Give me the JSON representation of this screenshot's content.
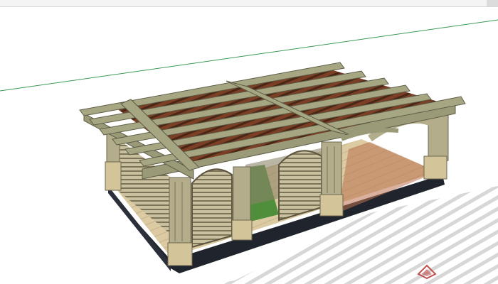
{
  "viewport": {
    "model": "pergola",
    "background": "#ffffff",
    "axis_color": "#3a9a55",
    "roof_color": "#7a3f24",
    "beam_color": "#9a9a78",
    "column_color": "#b3ad8c",
    "floor_color": "#d9c9a3",
    "lawn_color": "#4f8f3c",
    "base_color": "#20242d",
    "logo_color": "#c0504d"
  },
  "icons": {
    "logo": "watermark-logo"
  }
}
